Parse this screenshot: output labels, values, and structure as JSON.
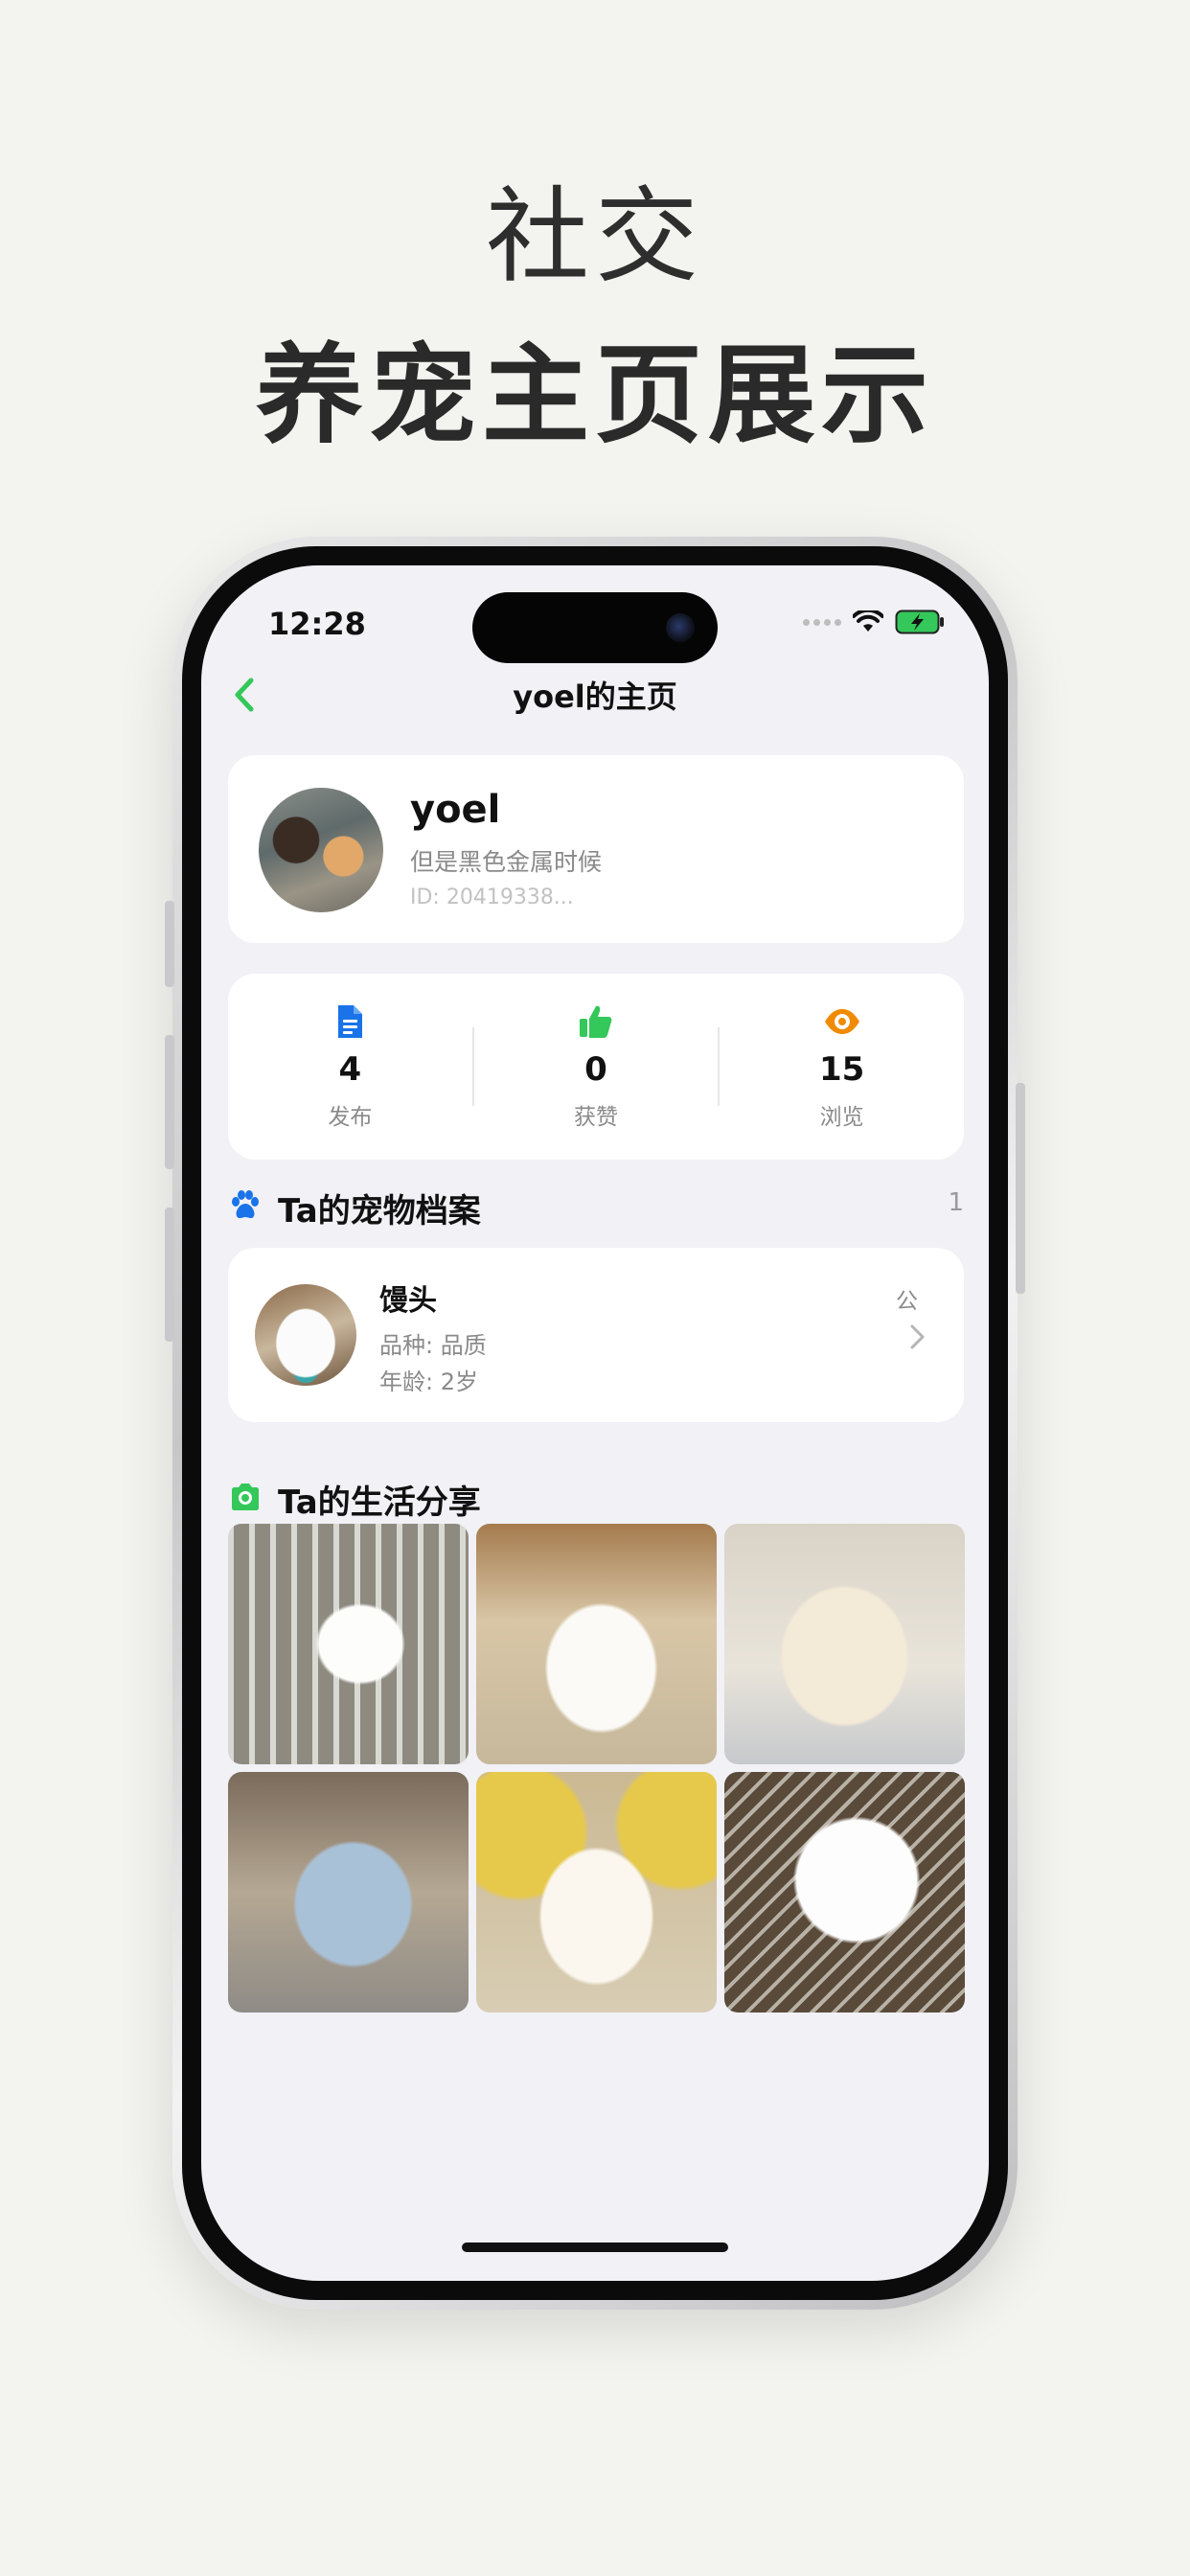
{
  "hero": {
    "subtitle": "社交",
    "title": "养宠主页展示"
  },
  "status_bar": {
    "time": "12:28"
  },
  "nav": {
    "title": "yoel的主页"
  },
  "profile": {
    "name": "yoel",
    "bio": "但是黑色金属时候",
    "id_text": "ID: 20419338..."
  },
  "stats": [
    {
      "icon": "document-icon",
      "value": "4",
      "label": "发布",
      "color": "#1a73e8"
    },
    {
      "icon": "thumbs-up-icon",
      "value": "0",
      "label": "获赞",
      "color": "#34c759"
    },
    {
      "icon": "eye-icon",
      "value": "15",
      "label": "浏览",
      "color": "#f08a00"
    }
  ],
  "pet_section": {
    "icon": "paw-icon",
    "title": "Ta的宠物档案",
    "count": "1"
  },
  "pet": {
    "name": "馒头",
    "breed": "品种: 品质",
    "age": "年龄: 2岁",
    "badge": "公"
  },
  "life_section": {
    "icon": "camera-icon",
    "title": "Ta的生活分享"
  },
  "colors": {
    "accent_green": "#34c759",
    "blue": "#1a73e8",
    "orange": "#f08a00",
    "background": "#f1f1f6"
  }
}
